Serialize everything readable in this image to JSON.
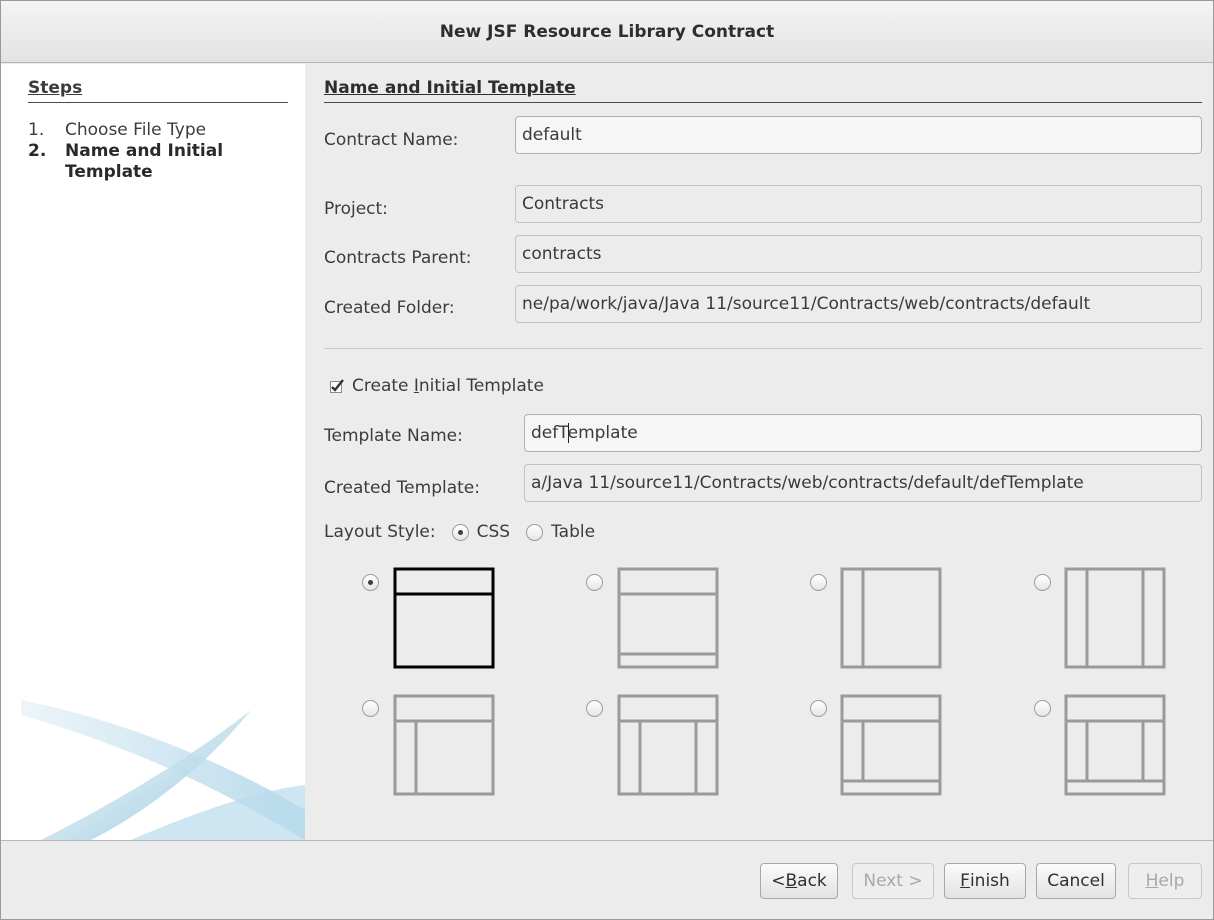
{
  "window": {
    "title": "New JSF Resource Library Contract"
  },
  "steps": {
    "title": "Steps",
    "items": [
      {
        "num": "1.",
        "label": "Choose File Type",
        "current": false
      },
      {
        "num": "2.",
        "label": "Name and Initial Template",
        "current": true
      }
    ]
  },
  "section": {
    "title": "Name and Initial Template"
  },
  "form": {
    "contract_name_label": "Contract Name:",
    "contract_name_value": "default",
    "project_label": "Project:",
    "project_value": "Contracts",
    "contracts_parent_label": "Contracts Parent:",
    "contracts_parent_value": "contracts",
    "created_folder_label": "Created Folder:",
    "created_folder_value": "ne/pa/work/java/Java 11/source11/Contracts/web/contracts/default",
    "create_template_label_pre": "Create ",
    "create_template_label_mnemonic": "I",
    "create_template_label_post": "nitial Template",
    "create_template_checked": true,
    "template_name_label": "Template Name:",
    "template_name_value_pre": "defT",
    "template_name_value_post": "emplate",
    "created_template_label": "Created Template:",
    "created_template_value": "a/Java 11/source11/Contracts/web/contracts/default/defTemplate",
    "layout_style_label": "Layout Style:",
    "layout_options": [
      {
        "label": "CSS",
        "selected": true
      },
      {
        "label": "Table",
        "selected": false
      }
    ]
  },
  "templates": [
    {
      "icon": "header-content-layout-icon",
      "selected": true
    },
    {
      "icon": "header-content-footer-layout-icon",
      "selected": false
    },
    {
      "icon": "left-sidebar-layout-icon",
      "selected": false
    },
    {
      "icon": "left-right-sidebar-layout-icon",
      "selected": false
    },
    {
      "icon": "header-left-sidebar-layout-icon",
      "selected": false
    },
    {
      "icon": "header-left-right-sidebar-layout-icon",
      "selected": false
    },
    {
      "icon": "header-left-sidebar-footer-layout-icon",
      "selected": false
    },
    {
      "icon": "header-left-right-sidebar-footer-layout-icon",
      "selected": false
    }
  ],
  "buttons": {
    "back_pre": "< ",
    "back_mn": "B",
    "back_post": "ack",
    "next": "Next >",
    "finish_mn": "F",
    "finish_post": "inish",
    "cancel": "Cancel",
    "help_mn": "H",
    "help_post": "elp"
  },
  "colors": {
    "selected_icon": "#000000",
    "unselected_icon": "#9a9a9a"
  }
}
